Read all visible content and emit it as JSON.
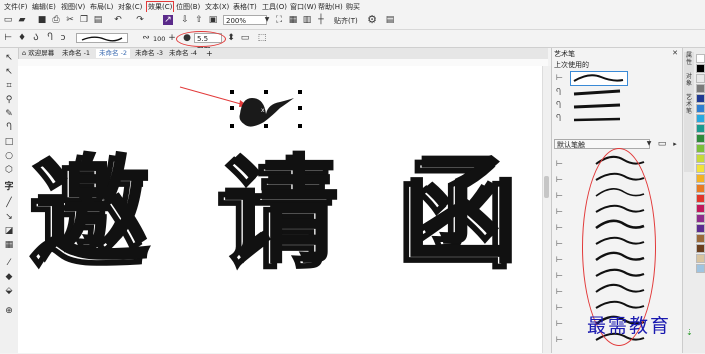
{
  "menu": [
    "文件(F)",
    "编辑(E)",
    "视图(V)",
    "布局(L)",
    "对象(C)",
    "效果(C)",
    "位图(B)",
    "文本(X)",
    "表格(T)",
    "工具(O)",
    "窗口(W)",
    "帮助(H)",
    "购买"
  ],
  "toolbar": {
    "zoom": "200%",
    "snap_label": "贴齐(T)",
    "zoom_percent": "100",
    "stroke_width": "5.5 mm"
  },
  "tabs": [
    "欢迎屏幕",
    "未命名 -1",
    "未命名 -2",
    "未命名 -3",
    "未命名 -4"
  ],
  "active_tab_index": 2,
  "canvas": {
    "text_chars": [
      "邀",
      "请",
      "函"
    ]
  },
  "docker": {
    "title": "艺术笔",
    "recent_label": "上次使用的",
    "preset_label": "默认笔触"
  },
  "watermark": "最需教育",
  "palette_colors": [
    "#ffffff",
    "#000000",
    "#e8e8e8",
    "#7a7a7a",
    "#1f3a93",
    "#2f7fd1",
    "#28a9e0",
    "#1b9a8e",
    "#2e8b3a",
    "#7cbf3a",
    "#c8d93a",
    "#f2e23a",
    "#f4b223",
    "#e97a22",
    "#e2352b",
    "#c2185b",
    "#8e2c8c",
    "#5c2d91",
    "#9a6a3a",
    "#6b3f1f",
    "#d8c4a0",
    "#a0c4e0"
  ],
  "colors": {
    "accent_red": "#e23a3a",
    "selection_blue": "#3a8ad6"
  }
}
